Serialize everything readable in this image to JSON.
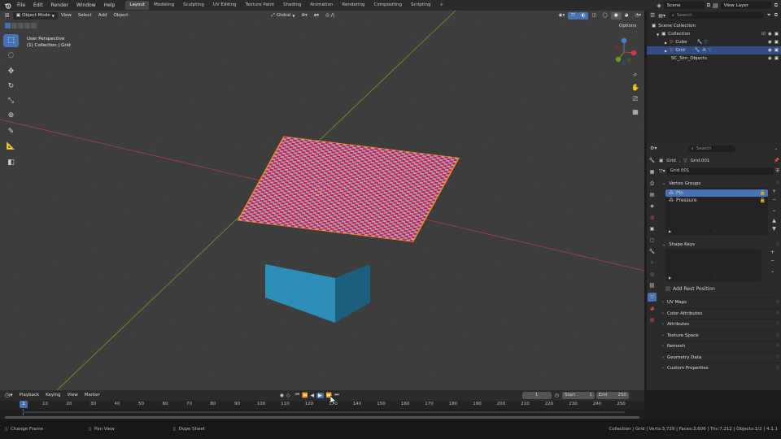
{
  "topbar": {
    "menus": [
      "File",
      "Edit",
      "Render",
      "Window",
      "Help"
    ],
    "workspaces": [
      "Layout",
      "Modeling",
      "Sculpting",
      "UV Editing",
      "Texture Paint",
      "Shading",
      "Animation",
      "Rendering",
      "Compositing",
      "Scripting"
    ],
    "active_workspace": "Layout",
    "add_workspace": "+",
    "scene": "Scene",
    "view_layer": "View Layer"
  },
  "viewport_header": {
    "mode": "Object Mode",
    "menus": [
      "View",
      "Select",
      "Add",
      "Object"
    ],
    "orientation": "Global",
    "options": "Options"
  },
  "viewport": {
    "perspective": "User Perspective",
    "collection_label": "(1) Collection | Grid"
  },
  "outliner": {
    "search_placeholder": "Search",
    "rows": [
      {
        "label": "Scene Collection"
      },
      {
        "label": "Collection"
      },
      {
        "label": "Cube"
      },
      {
        "label": "Grid"
      },
      {
        "label": "SC_Sim_Objects"
      }
    ]
  },
  "properties": {
    "search_placeholder": "Search",
    "breadcrumb_object": "Grid",
    "breadcrumb_data": "Grid.001",
    "data_name": "Grid.001",
    "vertex_groups": {
      "title": "Vertex Groups",
      "items": [
        "Pin",
        "Pressure"
      ]
    },
    "shape_keys": {
      "title": "Shape Keys"
    },
    "add_rest_position": "Add Rest Position",
    "collapsed_panels": [
      "UV Maps",
      "Color Attributes",
      "Attributes",
      "Texture Space",
      "Remesh",
      "Geometry Data",
      "Custom Properties"
    ]
  },
  "timeline": {
    "menus": [
      "Playback",
      "Keying",
      "View",
      "Marker"
    ],
    "current_frame": "1",
    "start_label": "Start",
    "start_value": "1",
    "end_label": "End",
    "end_value": "250",
    "ticks": [
      "1",
      "10",
      "20",
      "30",
      "40",
      "50",
      "60",
      "70",
      "80",
      "90",
      "100",
      "110",
      "120",
      "130",
      "140",
      "150",
      "160",
      "170",
      "180",
      "190",
      "200",
      "210",
      "220",
      "230",
      "240",
      "250"
    ]
  },
  "statusbar": {
    "hint1": "Change Frame",
    "hint2": "Pan View",
    "hint3": "Dope Sheet",
    "stats": "Collection | Grid | Verts:3,729 | Faces:3,606 | Tris:7,212 | Objects:1/2 | 4.1.1"
  },
  "colors": {
    "accent": "#4772b3",
    "checker_a": "#c9185f",
    "checker_b": "#a8a8a8",
    "cube": "#2d8fb8",
    "selection_outline": "#f08a1c"
  }
}
